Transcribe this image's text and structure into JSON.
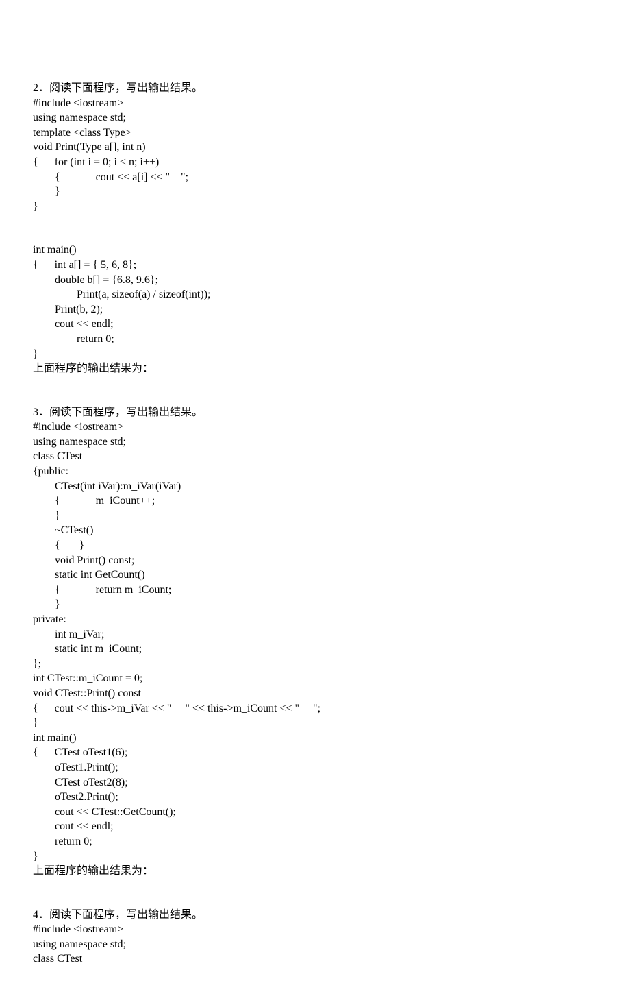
{
  "q2": {
    "title": "2．阅读下面程序，写出输出结果。",
    "lines": [
      "#include <iostream>",
      "using namespace std;",
      "template <class Type>",
      "void Print(Type a[], int n)",
      "{      for (int i = 0; i < n; i++)",
      "        {             cout << a[i] << \"    \";",
      "        }",
      "}",
      "",
      "",
      "int main()",
      "{      int a[] = { 5, 6, 8};",
      "        double b[] = {6.8, 9.6};",
      "                Print(a, sizeof(a) / sizeof(int));",
      "        Print(b, 2);",
      "        cout << endl;",
      "                return 0;",
      "}",
      "上面程序的输出结果为："
    ]
  },
  "q3": {
    "title": "3．阅读下面程序，写出输出结果。",
    "lines": [
      "#include <iostream>",
      "using namespace std;",
      "class CTest",
      "{public:",
      "        CTest(int iVar):m_iVar(iVar)",
      "        {             m_iCount++;",
      "        }",
      "        ~CTest()",
      "        {       }",
      "        void Print() const;",
      "        static int GetCount()",
      "        {             return m_iCount;",
      "        }",
      "private:",
      "        int m_iVar;",
      "        static int m_iCount;",
      "};",
      "int CTest::m_iCount = 0;",
      "void CTest::Print() const",
      "{      cout << this->m_iVar << \"     \" << this->m_iCount << \"     \";",
      "}",
      "int main()",
      "{      CTest oTest1(6);",
      "        oTest1.Print();",
      "        CTest oTest2(8);",
      "        oTest2.Print();",
      "        cout << CTest::GetCount();",
      "        cout << endl;",
      "        return 0;",
      "}",
      "上面程序的输出结果为："
    ]
  },
  "q4": {
    "title": "4．阅读下面程序，写出输出结果。",
    "lines": [
      "#include <iostream>",
      "using namespace std;",
      "class CTest"
    ]
  }
}
